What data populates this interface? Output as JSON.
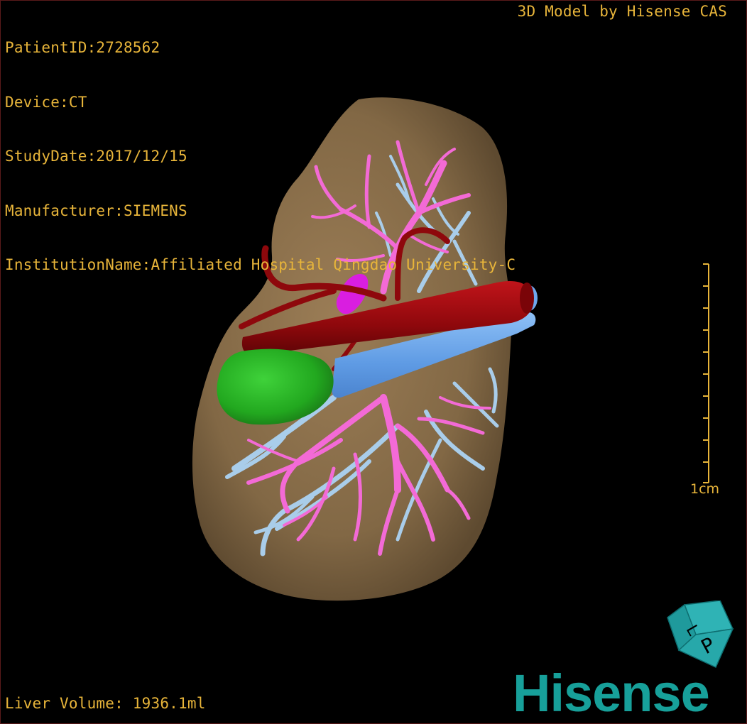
{
  "header": {
    "patient_id": "PatientID:2728562",
    "device": "Device:CT",
    "study_date": "StudyDate:2017/12/15",
    "manufacturer": "Manufacturer:SIEMENS",
    "institution": "InstitutionName:Affiliated Hospital Qingdao University-C"
  },
  "top_right": {
    "model_credit": "3D Model by Hisense CAS"
  },
  "footer": {
    "liver_volume": "Liver Volume: 1936.1ml"
  },
  "scale_bar": {
    "label": "1cm"
  },
  "orientation_cube": {
    "front_letter": "P",
    "side_letter": "L",
    "icon": "orientation-cube-icon"
  },
  "brand": {
    "logo_text": "Hisense"
  },
  "colors": {
    "overlay_text": "#e8b53a",
    "liver": "#8a6e4a",
    "hepatic_vein": "#f36ad6",
    "portal_vein": "#a9cdea",
    "artery": "#9c0c10",
    "ivc": "#6ea8ee",
    "gallbladder": "#2fb82a",
    "brand": "#17a09a"
  }
}
